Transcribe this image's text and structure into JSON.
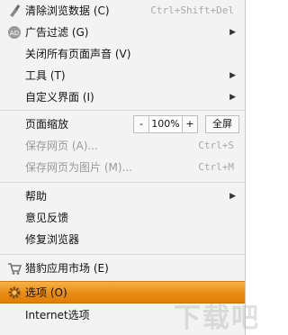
{
  "menu": {
    "items": [
      {
        "label": "清除浏览数据 (C)",
        "shortcut": "Ctrl+Shift+Del",
        "icon": "broom-icon"
      },
      {
        "label": "广告过滤 (G)",
        "icon": "ad-filter-icon"
      },
      {
        "label": "关闭所有页面声音 (V)"
      },
      {
        "label": "工具 (T)"
      },
      {
        "label": "自定义界面 (I)"
      },
      {
        "label": "页面缩放"
      },
      {
        "label": "保存网页 (A)...",
        "shortcut": "Ctrl+S"
      },
      {
        "label": "保存网页为图片 (M)...",
        "shortcut": "Ctrl+M"
      },
      {
        "label": "帮助"
      },
      {
        "label": "意见反馈"
      },
      {
        "label": "修复浏览器"
      },
      {
        "label": "猎豹应用市场 (E)",
        "icon": "cart-icon"
      },
      {
        "label": "选项 (O)",
        "icon": "gear-icon"
      },
      {
        "label": "Internet选项"
      }
    ],
    "zoom": {
      "minus": "-",
      "value": "100%",
      "plus": "+",
      "fullscreen": "全屏"
    },
    "submenu_arrow": "▶"
  },
  "watermark": "下载吧",
  "colors": {
    "highlight": "#e98b12",
    "menu_bg": "#f3f3f3"
  }
}
